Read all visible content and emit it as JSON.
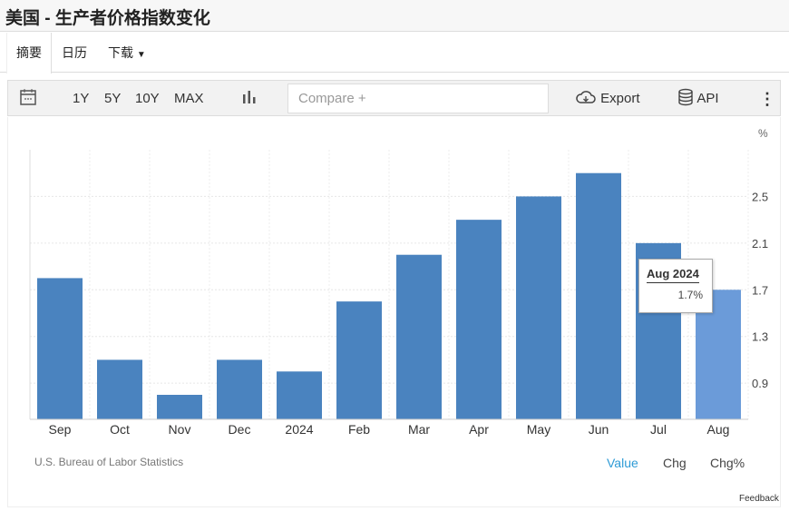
{
  "title": "美国 - 生产者价格指数变化",
  "tabs": [
    "摘要",
    "日历",
    "下载"
  ],
  "toolbar": {
    "ranges": [
      "1Y",
      "5Y",
      "10Y",
      "MAX"
    ],
    "compare_placeholder": "Compare +",
    "export": "Export",
    "api": "API"
  },
  "source": "U.S. Bureau of Labor Statistics",
  "modes": [
    "Value",
    "Chg",
    "Chg%"
  ],
  "feedback": "Feedback",
  "tooltip": {
    "label": "Aug 2024",
    "value": "1.7%"
  },
  "colors": {
    "bar": "#4a83bf",
    "highlight": "#6b9bd9",
    "accent": "#2e9bd6"
  },
  "chart_data": {
    "type": "bar",
    "unit": "%",
    "categories": [
      "Sep",
      "Oct",
      "Nov",
      "Dec",
      "2024",
      "Feb",
      "Mar",
      "Apr",
      "May",
      "Jun",
      "Jul",
      "Aug"
    ],
    "values": [
      1.8,
      1.1,
      0.8,
      1.1,
      1.0,
      1.6,
      2.0,
      2.3,
      2.5,
      2.7,
      2.1,
      1.7
    ],
    "yticks": [
      0.9,
      1.3,
      1.7,
      2.1,
      2.5
    ],
    "ylim": [
      0.59,
      2.9
    ],
    "highlighted": "Aug",
    "grid": true
  }
}
